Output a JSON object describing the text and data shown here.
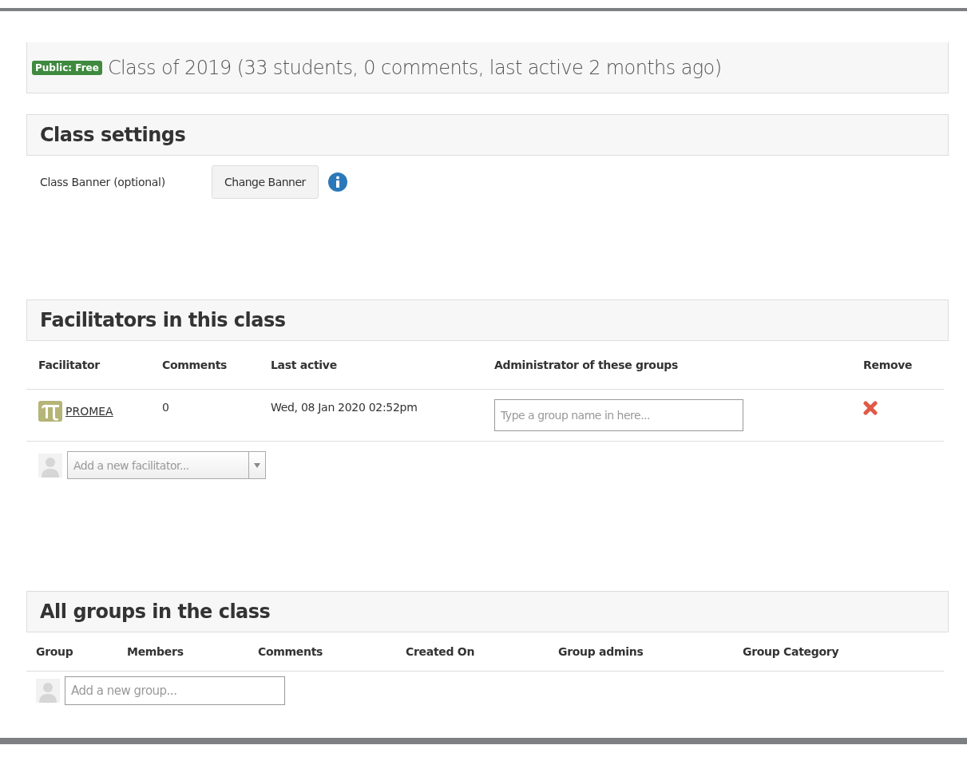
{
  "class_summary": {
    "badge": "Public: Free",
    "title": "Class of 2019 (33 students, 0 comments, last active 2 months ago)"
  },
  "class_settings": {
    "heading": "Class settings",
    "banner_label": "Class Banner (optional)",
    "banner_button": "Change Banner"
  },
  "facilitators": {
    "heading": "Facilitators in this class",
    "columns": [
      "Facilitator",
      "Comments",
      "Last active",
      "Administrator of these groups",
      "Remove"
    ],
    "rows": [
      {
        "name": "PROMEA",
        "comments": "0",
        "last_active": "Wed, 08 Jan 2020 02:52pm",
        "groups_placeholder": "Type a group name in here..."
      }
    ],
    "add_placeholder": "Add a new facilitator..."
  },
  "groups": {
    "heading": "All groups in the class",
    "columns": [
      "Group",
      "Members",
      "Comments",
      "Created On",
      "Group admins",
      "Group Category"
    ],
    "add_placeholder": "Add a new group..."
  }
}
